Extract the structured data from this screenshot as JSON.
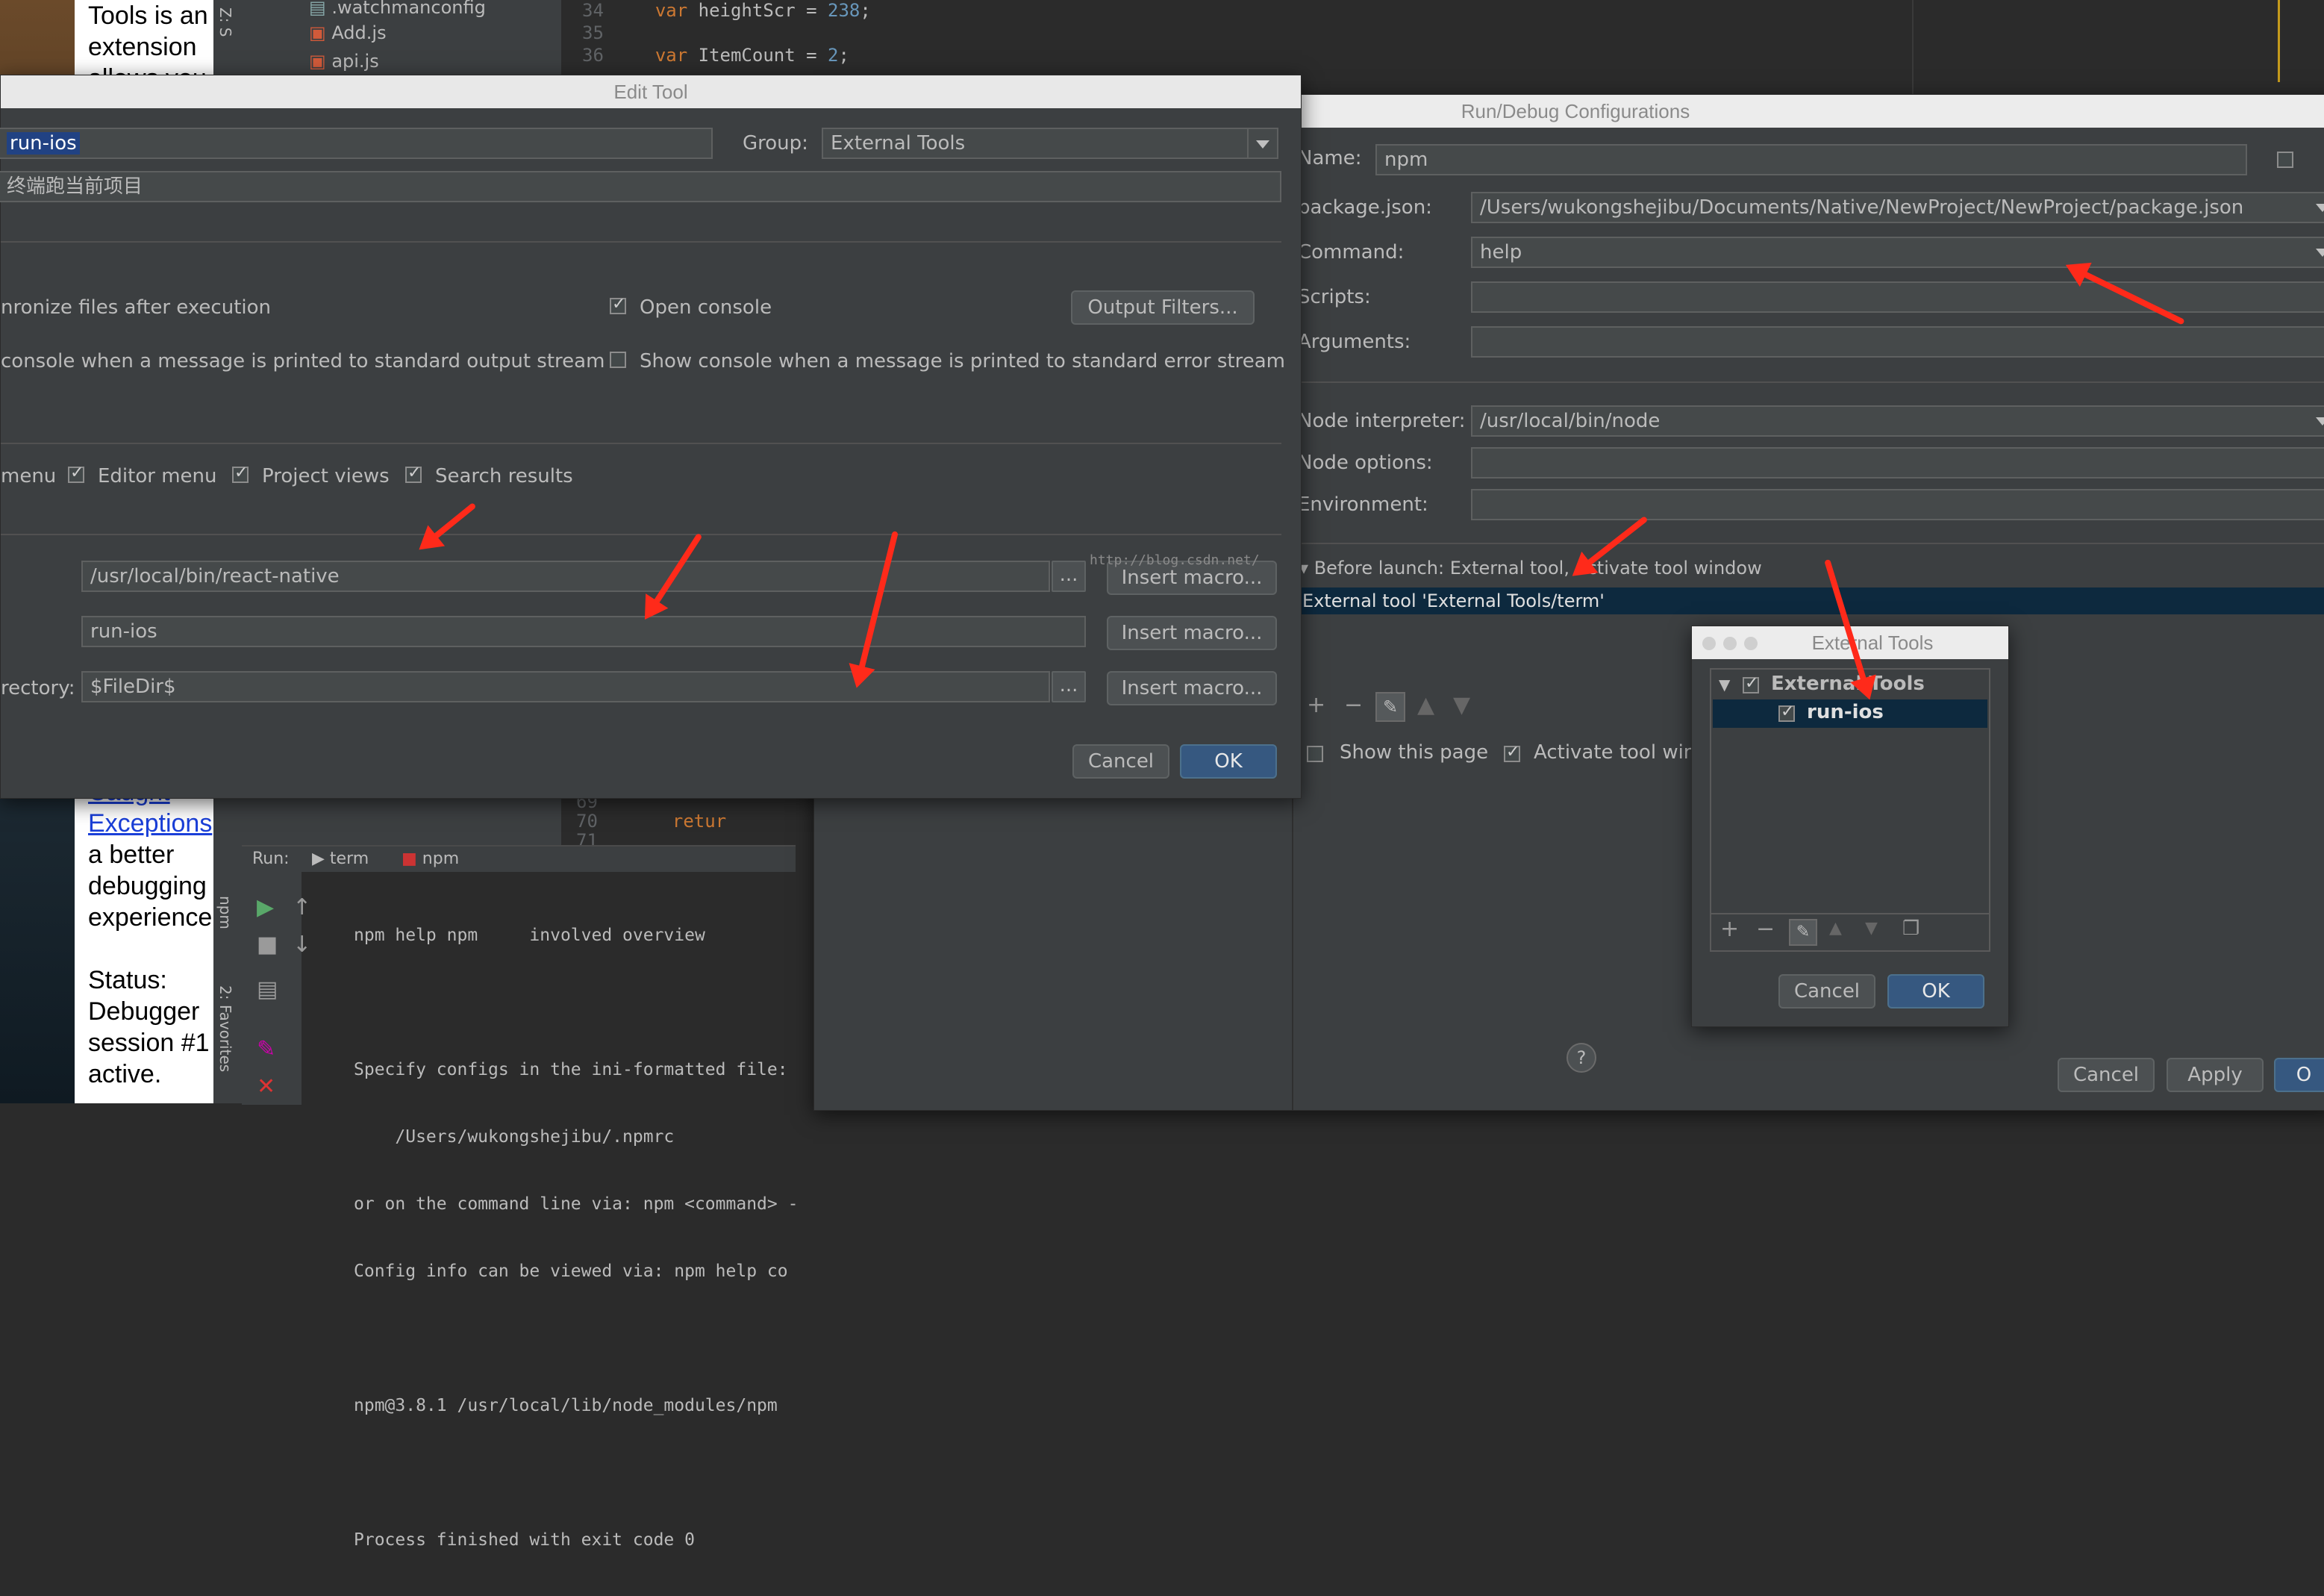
{
  "background": {
    "sidebar_text": [
      "Tools is an",
      "extension",
      "allows you"
    ],
    "sidebar_text_lower": [
      "Caught",
      "Exceptions",
      "a better",
      "debugging",
      "experience",
      "",
      "Status:",
      "Debugger",
      "session #1",
      "active."
    ],
    "tree_files": [
      ".watchmanconfig",
      "Add.js",
      "api.js"
    ],
    "code_lines": [
      {
        "n": "34",
        "kw": "var",
        "name": "heightScr",
        "val": "238"
      },
      {
        "n": "35",
        "kw": "",
        "name": "",
        "val": ""
      },
      {
        "n": "36",
        "kw": "var",
        "name": "ItemCount",
        "val": "2"
      }
    ],
    "code_lower": [
      {
        "n": "69",
        "text": ""
      },
      {
        "n": "70",
        "text": "retur"
      },
      {
        "n": "71",
        "text": ""
      }
    ],
    "side_tabs": [
      "Z: S",
      "npm",
      "2: Favorites"
    ],
    "watermark": "http://blog.csdn.net/"
  },
  "run_panel": {
    "label": "Run:",
    "tabs": [
      "term",
      "npm"
    ],
    "output": [
      "npm help npm     involved overview",
      "",
      "Specify configs in the ini-formatted file:",
      "    /Users/wukongshejibu/.npmrc",
      "or on the command line via: npm <command> -",
      "Config info can be viewed via: npm help co",
      "",
      "npm@3.8.1 /usr/local/lib/node_modules/npm",
      "",
      "Process finished with exit code 0"
    ]
  },
  "edit_tool": {
    "title": "Edit Tool",
    "name_value": "run-ios",
    "group_label": "Group:",
    "group_value": "External Tools",
    "description_value": "终端跑当前项目",
    "sync_label": "nronize files after execution",
    "open_console_label": "Open console",
    "output_filters_label": "Output Filters...",
    "show_stdout_label": "console when a message is printed to standard output stream",
    "show_stderr_label": "Show console when a message is printed to standard error stream",
    "menu_label": "menu",
    "editor_menu_label": "Editor menu",
    "project_views_label": "Project views",
    "search_results_label": "Search results",
    "program_value": "/usr/local/bin/react-native",
    "parameters_value": "run-ios",
    "working_dir_label": "rectory:",
    "working_dir_value": "$FileDir$",
    "browse_label": "...",
    "insert_macro_label": "Insert macro...",
    "cancel_label": "Cancel",
    "ok_label": "OK"
  },
  "run_debug": {
    "title": "Run/Debug Configurations",
    "name_label": "Name:",
    "name_value": "npm",
    "package_label": "package.json:",
    "package_value": "/Users/wukongshejibu/Documents/Native/NewProject/NewProject/package.json",
    "command_label": "Command:",
    "command_value": "help",
    "scripts_label": "Scripts:",
    "arguments_label": "Arguments:",
    "node_interp_label": "Node interpreter:",
    "node_interp_value": "/usr/local/bin/node",
    "node_options_label": "Node options:",
    "environment_label": "Environment:",
    "before_launch_label": "Before launch: External tool, Activate tool window",
    "external_tool_item": "External tool 'External Tools/term'",
    "show_page_label": "Show this page",
    "activate_window_label": "Activate tool wind",
    "cancel_label": "Cancel",
    "apply_label": "Apply",
    "ok_label": "O"
  },
  "external_tools": {
    "title": "External Tools",
    "group_label": "External Tools",
    "item_label": "run-ios",
    "cancel_label": "Cancel",
    "ok_label": "OK"
  },
  "colors": {
    "accent_arrow": "#ff2a1a",
    "selection": "#0d293e",
    "primary_button": "#365880"
  }
}
